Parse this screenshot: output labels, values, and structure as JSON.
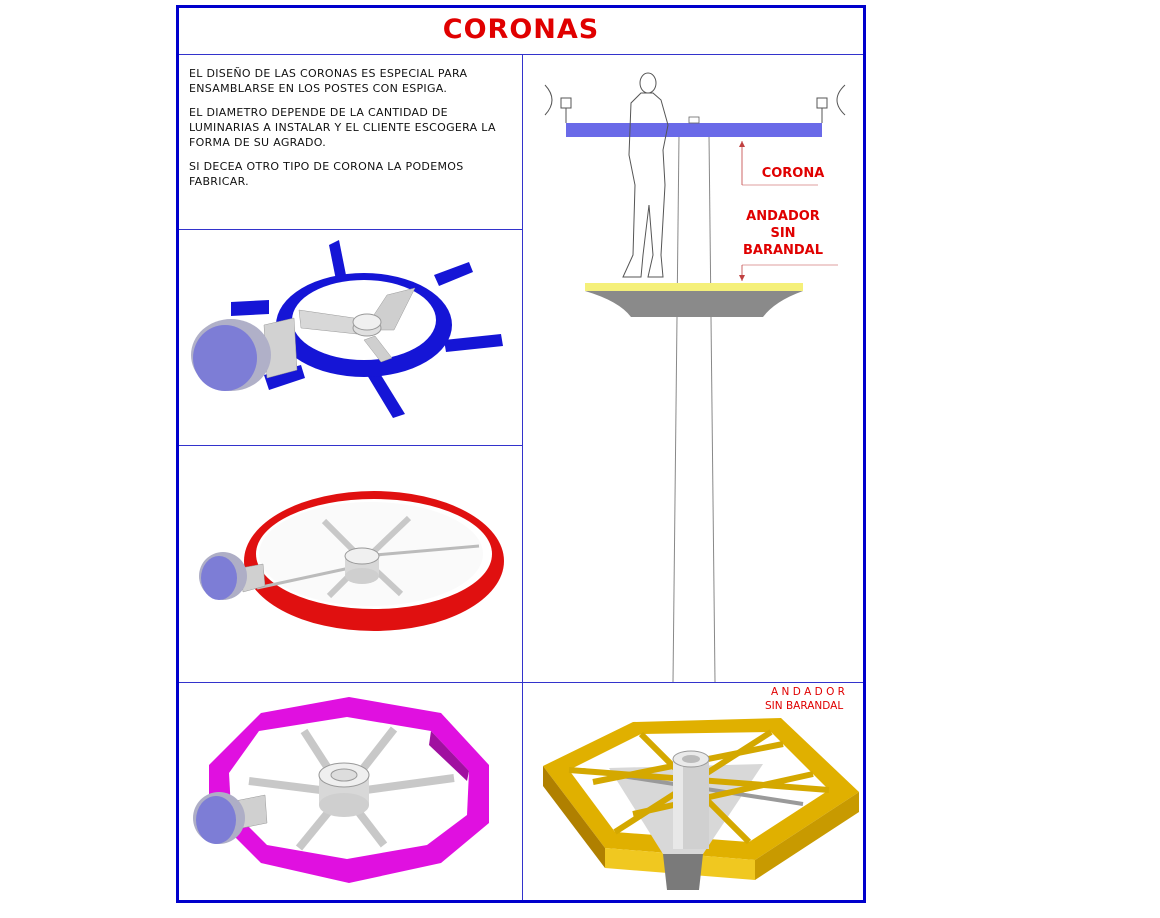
{
  "sheet": {
    "title": "CORONAS",
    "description": [
      "EL DISEÑO DE LAS CORONAS ES ESPECIAL PARA ENSAMBLARSE  EN LOS POSTES CON ESPIGA.",
      "EL  DIAMETRO DEPENDE  DE LA CANTIDAD DE LUMINARIAS  A INSTALAR Y EL CLIENTE ESCOGERA LA FORMA DE SU AGRADO.",
      "SI DECEA OTRO TIPO DE CORONA  LA   PODEMOS FABRICAR."
    ]
  },
  "elevation": {
    "corona_label": "CORONA",
    "andador_label_line1": "ANDADOR",
    "andador_label_line2": "SIN",
    "andador_label_line3": "BARANDAL"
  },
  "hex_panel": {
    "label_line1": "A N D A D O R",
    "label_line2": "SIN BARANDAL"
  },
  "colors": {
    "border": "#0000cc",
    "title": "#e00000",
    "blue_crown": "#1515d6",
    "red_crown": "#e01010",
    "magenta_crown": "#e010e0",
    "gold_walkway": "#e0b000",
    "corona_bar": "#6a6ae8",
    "walkway_top": "#f5f07a"
  },
  "icons": [
    "luminaire-icon",
    "person-figure",
    "pole-icon"
  ]
}
